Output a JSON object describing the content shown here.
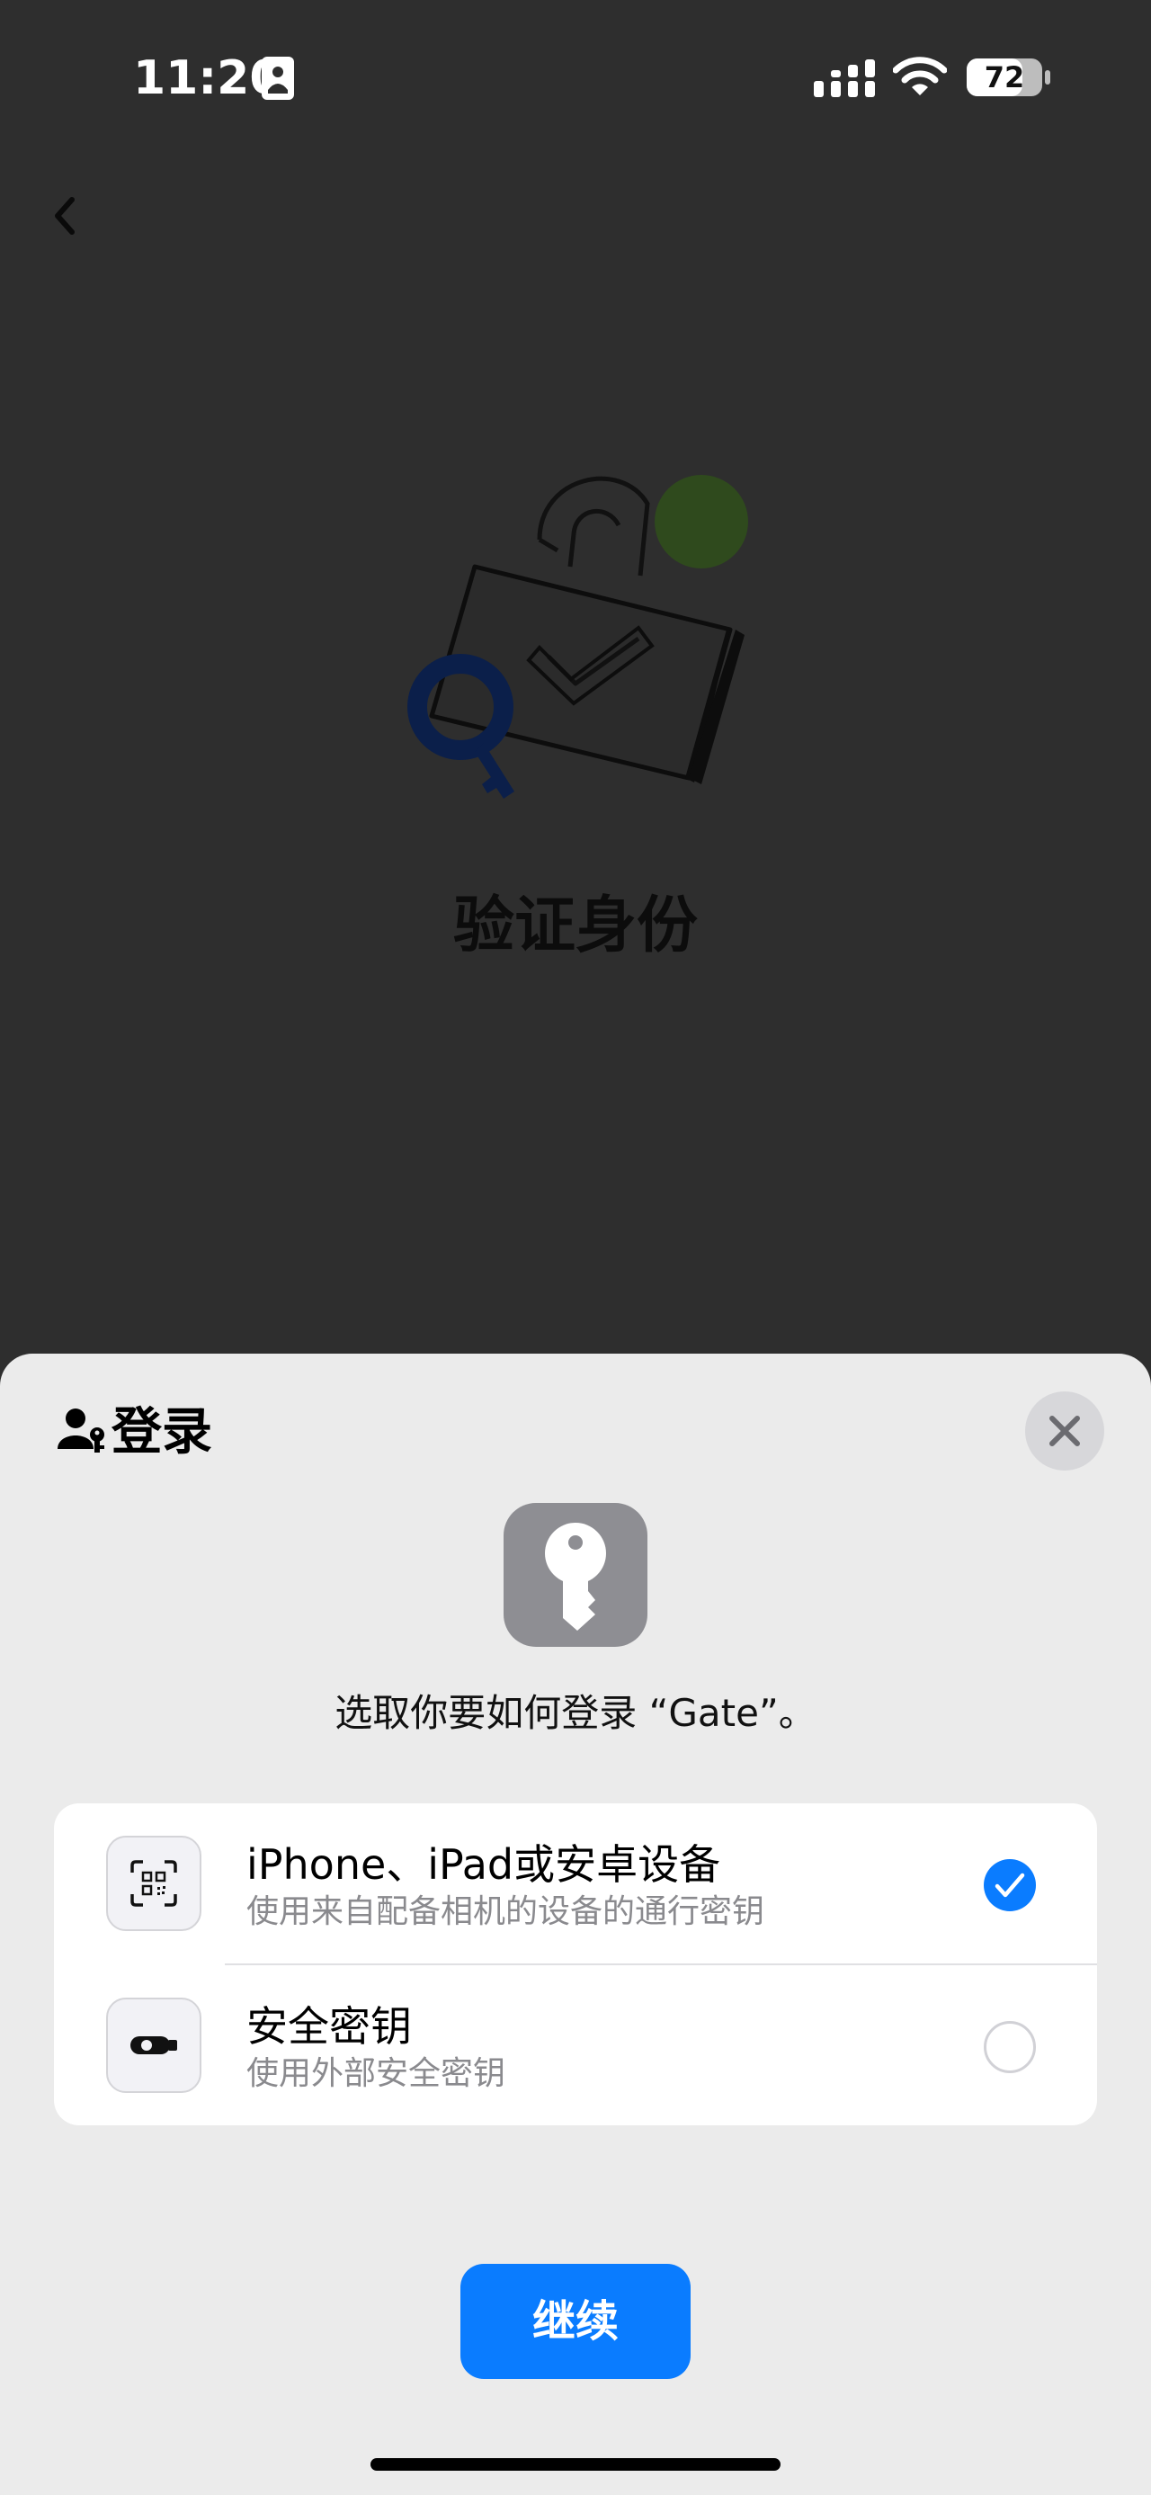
{
  "status_bar": {
    "time": "11:20",
    "battery_level": "72"
  },
  "page": {
    "title": "验证身份"
  },
  "sheet": {
    "header_label": "登录",
    "prompt": "选取你要如何登录 “Gate”。",
    "options": [
      {
        "title": "iPhone、iPad或安卓设备",
        "subtitle": "使用来自配备相机的设备的通行密钥",
        "selected": true,
        "icon": "qr-code-scan-icon"
      },
      {
        "title": "安全密钥",
        "subtitle": "使用外部安全密钥",
        "selected": false,
        "icon": "usb-security-key-icon"
      }
    ],
    "continue_label": "继续"
  },
  "colors": {
    "accent": "#0a7cff",
    "backdrop": "#2e2e2e",
    "sheet_bg": "#ebebeb"
  }
}
